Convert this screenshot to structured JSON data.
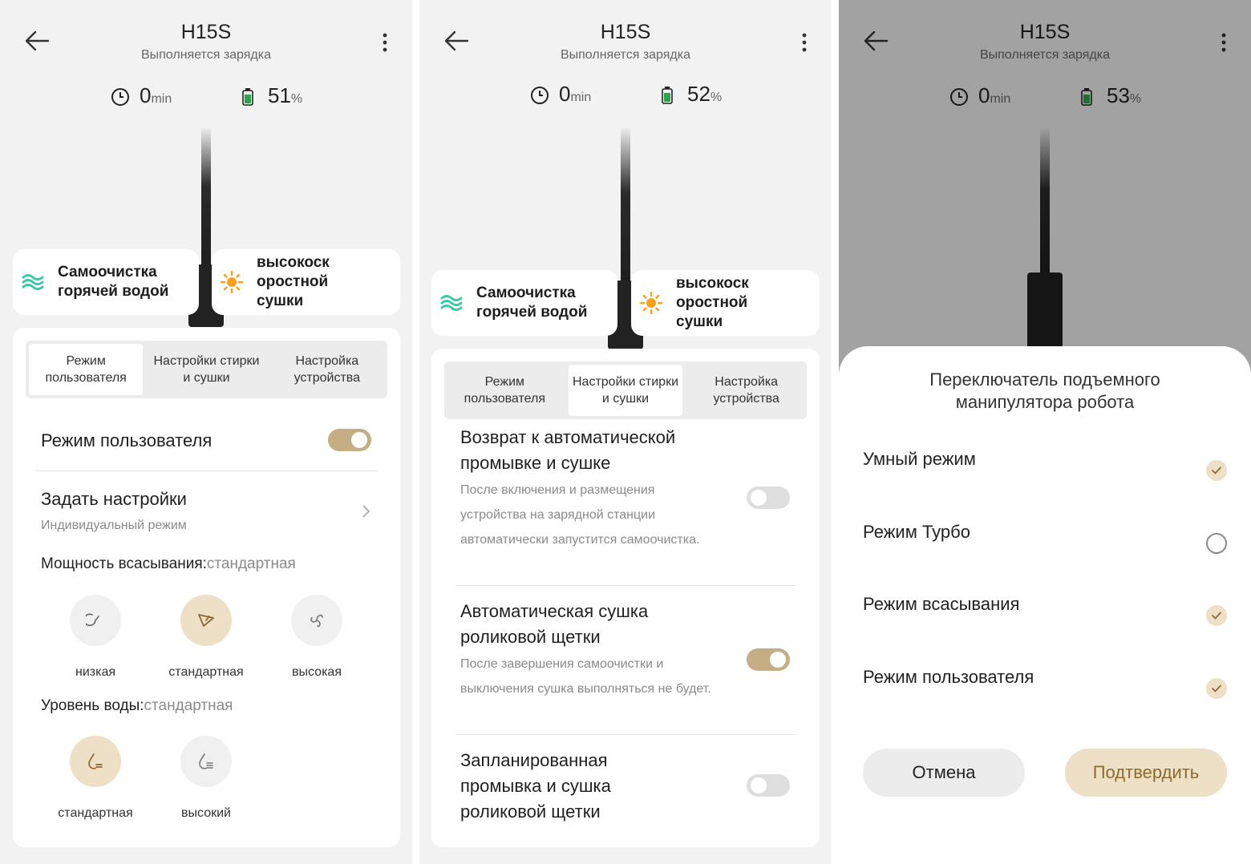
{
  "colors": {
    "accent": "#c5ad84",
    "accent_light": "#ede0c6",
    "battery": "#2fa34a",
    "clean_icon": "#3cc9a8",
    "sun_icon": "#ff9f1c"
  },
  "screens": [
    {
      "title": "H15S",
      "subtitle": "Выполняется зарядка",
      "time_value": "0",
      "time_unit": "min",
      "battery_value": "51",
      "battery_unit": "%",
      "chip_clean": "Самоочистка горячей водой",
      "chip_dry": "высокоскоростной сушки",
      "tabs": [
        "Режим пользователя",
        "Настройки стирки и сушки",
        "Настройка устройства"
      ],
      "active_tab": 0,
      "user_mode_label": "Режим пользователя",
      "user_mode_on": true,
      "settings_title": "Задать настройки",
      "settings_sub": "Индивидуальный режим",
      "suction_label": "Мощность всасывания:",
      "suction_value": "стандартная",
      "suction_options": [
        "низкая",
        "стандартная",
        "высокая"
      ],
      "suction_selected": 1,
      "water_label": "Уровень воды:",
      "water_value": "стандартная",
      "water_options": [
        "стандартная",
        "высокий"
      ],
      "water_selected": 0
    },
    {
      "title": "H15S",
      "subtitle": "Выполняется зарядка",
      "time_value": "0",
      "time_unit": "min",
      "battery_value": "52",
      "battery_unit": "%",
      "chip_clean": "Самоочистка горячей водой",
      "chip_dry": "высокоскоростной сушки",
      "tabs": [
        "Режим пользователя",
        "Настройки стирки и сушки",
        "Настройка устройства"
      ],
      "active_tab": 1,
      "items": [
        {
          "title": "Возврат к автоматической промывке и сушке",
          "desc": "После включения и размещения устройства на зарядной станции автоматически запустится самоочистка.",
          "on": false
        },
        {
          "title": "Автоматическая сушка роликовой щетки",
          "desc": "После завершения самоочистки и выключения сушка выполняться не будет.",
          "on": true
        },
        {
          "title": "Запланированная промывка и сушка роликовой щетки",
          "desc": "",
          "on": false
        }
      ]
    },
    {
      "title": "H15S",
      "subtitle": "Выполняется зарядка",
      "time_value": "0",
      "time_unit": "min",
      "battery_value": "53",
      "battery_unit": "%",
      "sheet_title": "Переключатель подъемного манипулятора робота",
      "options": [
        {
          "label": "Умный режим",
          "checked": true
        },
        {
          "label": "Режим Турбо",
          "checked": false
        },
        {
          "label": "Режим всасывания",
          "checked": true
        },
        {
          "label": "Режим пользователя",
          "checked": true
        }
      ],
      "cancel_label": "Отмена",
      "confirm_label": "Подтвердить"
    }
  ]
}
